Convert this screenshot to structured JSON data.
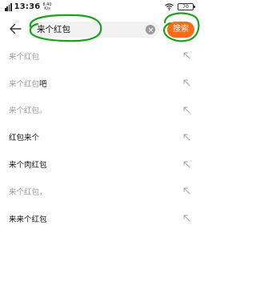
{
  "status_bar": {
    "time": "13:36",
    "speed_value": "8.40",
    "speed_unit": "K/s",
    "battery": "70"
  },
  "search": {
    "query": "来个红包",
    "button_label": "搜索"
  },
  "colors": {
    "accent": "#ff6a1a",
    "annotation": "#1ea01e",
    "muted_text": "#9b9b9b"
  },
  "suggestions": [
    {
      "matched": "来个红包",
      "rest": ""
    },
    {
      "matched": "来个红包",
      "rest": "吧"
    },
    {
      "matched": "来个红包。",
      "rest": ""
    },
    {
      "matched": "",
      "rest": "红包来个"
    },
    {
      "matched": "",
      "rest": "来个肉红包"
    },
    {
      "matched": "来个红包，",
      "rest": ""
    },
    {
      "matched": "",
      "rest": "来来个红包"
    }
  ],
  "icons": {
    "back": "arrow-left-icon",
    "clear": "clear-icon",
    "fill": "arrow-up-left-icon",
    "signal": "signal-icon",
    "wifi": "wifi-icon",
    "battery": "battery-icon"
  }
}
